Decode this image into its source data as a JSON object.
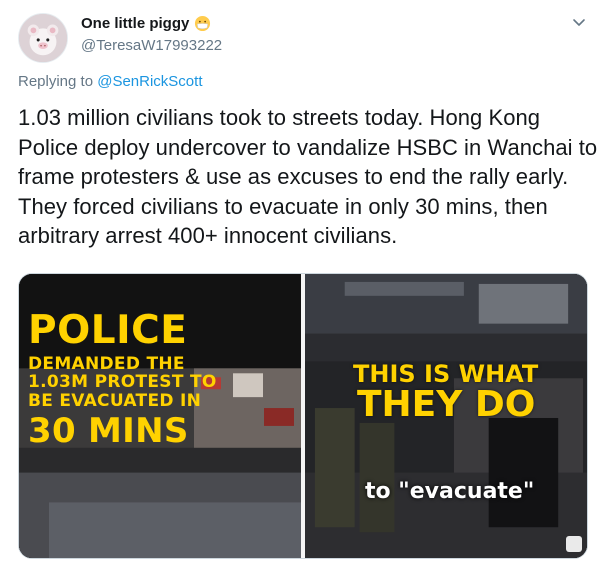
{
  "author": {
    "display_name": "One little piggy",
    "handle": "@TeresaW17993222",
    "name_emoji": "mask-face-emoji"
  },
  "reply": {
    "prefix": "Replying to",
    "mention": "@SenRickScott"
  },
  "tweet": {
    "text": "1.03 million civilians took to streets today. Hong Kong Police deploy undercover to vandalize HSBC in Wanchai to frame protesters & use as excuses to end the rally early. They forced civilians to evacuate in only 30 mins, then arbitrary arrest 400+ innocent civilians."
  },
  "media": {
    "left_panel": {
      "title": "POLICE",
      "line1": "DEMANDED THE",
      "line2": "1.03M PROTEST TO",
      "line3": "BE EVACUATED IN",
      "big": "30 MINS"
    },
    "right_panel": {
      "line1": "THIS IS WHAT",
      "line2": "THEY DO",
      "caption": "to \"evacuate\""
    }
  },
  "icons": {
    "caret": "chevron-down-icon",
    "media_badge": "gif-badge-icon"
  },
  "colors": {
    "text": "#14171a",
    "muted": "#657786",
    "link": "#1b95e0",
    "poster_yellow": "#ffd200"
  }
}
